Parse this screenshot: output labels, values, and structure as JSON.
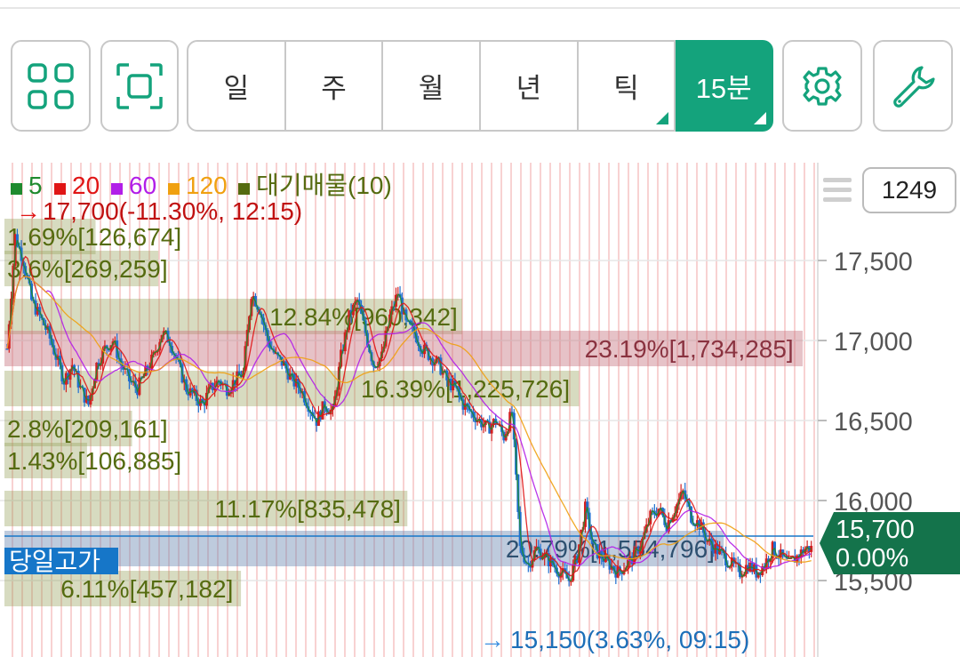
{
  "toolbar": {
    "grid_icon": "grid-4-icon",
    "fullscreen_icon": "focus-frame-icon",
    "periods": [
      "일",
      "주",
      "월",
      "년",
      "틱",
      "15분"
    ],
    "active_period": "15분",
    "settings_icon": "gear-icon",
    "tools_icon": "wrench-icon",
    "accent": "#14a37c"
  },
  "chart_data": {
    "type": "candlestick",
    "legend": [
      {
        "label": "5",
        "color": "#1f8a2e"
      },
      {
        "label": "20",
        "color": "#e01515"
      },
      {
        "label": "60",
        "color": "#b21ee8"
      },
      {
        "label": "120",
        "color": "#f0a010"
      },
      {
        "label": "대기매물(10)",
        "color": "#556b10"
      }
    ],
    "high_label": "17,700(-11.30%, 12:15)",
    "low_label": "15,150(3.63%, 09:15)",
    "y_ticks": [
      "17,500",
      "17,000",
      "16,500",
      "16,000",
      "15,500"
    ],
    "ylim": [
      15100,
      17800
    ],
    "current_price": "15,700",
    "current_change": "0.00%",
    "today_high_label": "당일고가",
    "candle_count": "1249",
    "volume_profile": [
      {
        "label": "1.69%[126,674]",
        "price": 17650,
        "pct": 1.69
      },
      {
        "label": "3.6%[269,259]",
        "price": 17450,
        "pct": 3.6
      },
      {
        "label": "12.84%[960,342]",
        "price": 17150,
        "pct": 12.84
      },
      {
        "label": "23.19%[1,734,285]",
        "price": 16950,
        "pct": 23.19
      },
      {
        "label": "16.39%[1,225,726]",
        "price": 16700,
        "pct": 16.39
      },
      {
        "label": "2.8%[209,161]",
        "price": 16450,
        "pct": 2.8
      },
      {
        "label": "1.43%[106,885]",
        "price": 16250,
        "pct": 1.43
      },
      {
        "label": "11.17%[835,478]",
        "price": 15950,
        "pct": 11.17
      },
      {
        "label": "20.79%[1,554,796]",
        "price": 15700,
        "pct": 20.79
      },
      {
        "label": "6.11%[457,182]",
        "price": 15450,
        "pct": 6.11
      }
    ],
    "close_path": [
      16950,
      17650,
      17500,
      17250,
      17150,
      17050,
      16900,
      16750,
      16850,
      16700,
      16600,
      16850,
      16950,
      17000,
      16850,
      16750,
      16700,
      16800,
      16900,
      17050,
      17000,
      16850,
      16700,
      16650,
      16600,
      16700,
      16750,
      16700,
      16750,
      16800,
      17300,
      17200,
      17000,
      16900,
      16850,
      16750,
      16700,
      16600,
      16500,
      16600,
      16550,
      16900,
      17150,
      17250,
      17050,
      16850,
      16900,
      17150,
      17300,
      17100,
      17050,
      16950,
      16900,
      16850,
      16750,
      16700,
      16600,
      16550,
      16500,
      16450,
      16500,
      16400,
      16550,
      15700,
      15600,
      15700,
      15650,
      15600,
      15550,
      15500,
      15650,
      15950,
      15700,
      15650,
      15600,
      15550,
      15600,
      15650,
      15750,
      15900,
      15950,
      15850,
      15950,
      16050,
      15900,
      15850,
      15750,
      15700,
      15650,
      15600,
      15550,
      15600,
      15550,
      15600,
      15700,
      15650,
      15600,
      15650,
      15700,
      15700
    ]
  }
}
